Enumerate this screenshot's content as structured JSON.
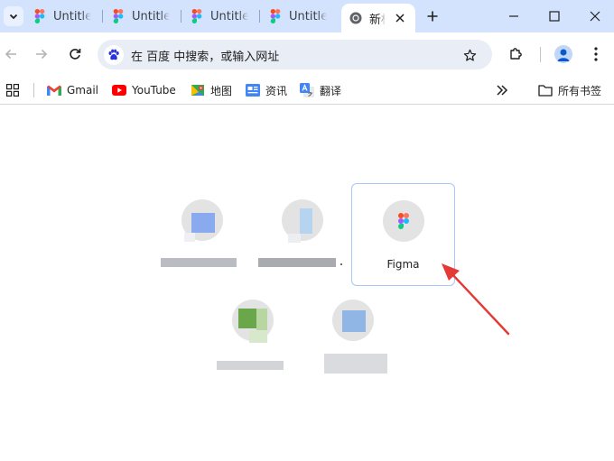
{
  "tabs": [
    {
      "label": "Untitled",
      "icon": "figma-icon"
    },
    {
      "label": "Untitled",
      "icon": "figma-icon"
    },
    {
      "label": "Untitled",
      "icon": "figma-icon"
    },
    {
      "label": "Untitled",
      "icon": "figma-icon"
    }
  ],
  "active_tab": {
    "label": "新标签页",
    "icon": "chrome-icon"
  },
  "omnibox": {
    "text": "在 百度 中搜索，或输入网址"
  },
  "bookmarks": [
    {
      "label": "Gmail",
      "icon": "gmail-icon"
    },
    {
      "label": "YouTube",
      "icon": "youtube-icon"
    },
    {
      "label": "地图",
      "icon": "maps-icon"
    },
    {
      "label": "资讯",
      "icon": "news-icon"
    },
    {
      "label": "翻译",
      "icon": "translate-icon"
    }
  ],
  "all_bookmarks_label": "所有书签",
  "shortcuts": {
    "figma_label": "Figma"
  },
  "colors": {
    "tabstrip": "#d3e3fd",
    "omnibox": "#e9eef6",
    "accent_blue": "#0b57d0",
    "hover_border": "#a8c7fa",
    "annotation_arrow": "#e53935"
  }
}
